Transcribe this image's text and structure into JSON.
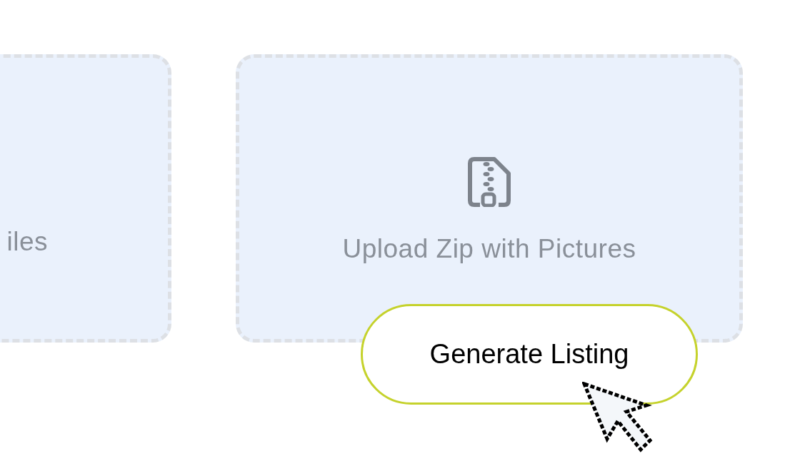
{
  "upload_cards": [
    {
      "label": "iles",
      "kind": "plain"
    },
    {
      "label": "Upload Zip with Pictures",
      "kind": "zip"
    }
  ],
  "generate_button": {
    "label": "Generate Listing"
  }
}
